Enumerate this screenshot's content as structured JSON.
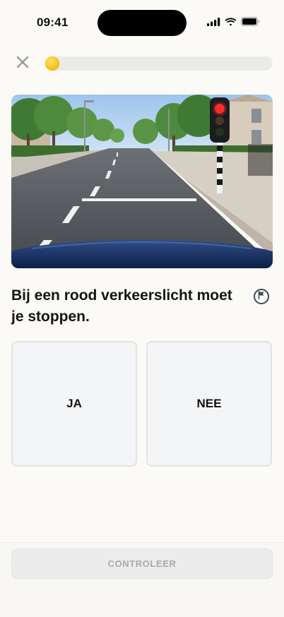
{
  "status_bar": {
    "time": "09:41",
    "icons": [
      "signal-icon",
      "wifi-icon",
      "battery-icon"
    ]
  },
  "top_bar": {
    "close_icon": "close-icon",
    "progress_fraction": 0.03
  },
  "question": {
    "image_description_icon": "traffic-light-road-photo",
    "text": "Bij een rood verkeerslicht moet je stoppen.",
    "flag_icon": "flag-icon"
  },
  "answers": [
    {
      "label": "JA"
    },
    {
      "label": "NEE"
    }
  ],
  "footer": {
    "check_label": "CONTROLEER"
  },
  "colors": {
    "background": "#fbfaf6",
    "progress_accent": "#f5c518",
    "answer_bg": "#f4f5f7",
    "button_disabled_bg": "#ececec",
    "button_disabled_text": "#a9a9a9"
  }
}
